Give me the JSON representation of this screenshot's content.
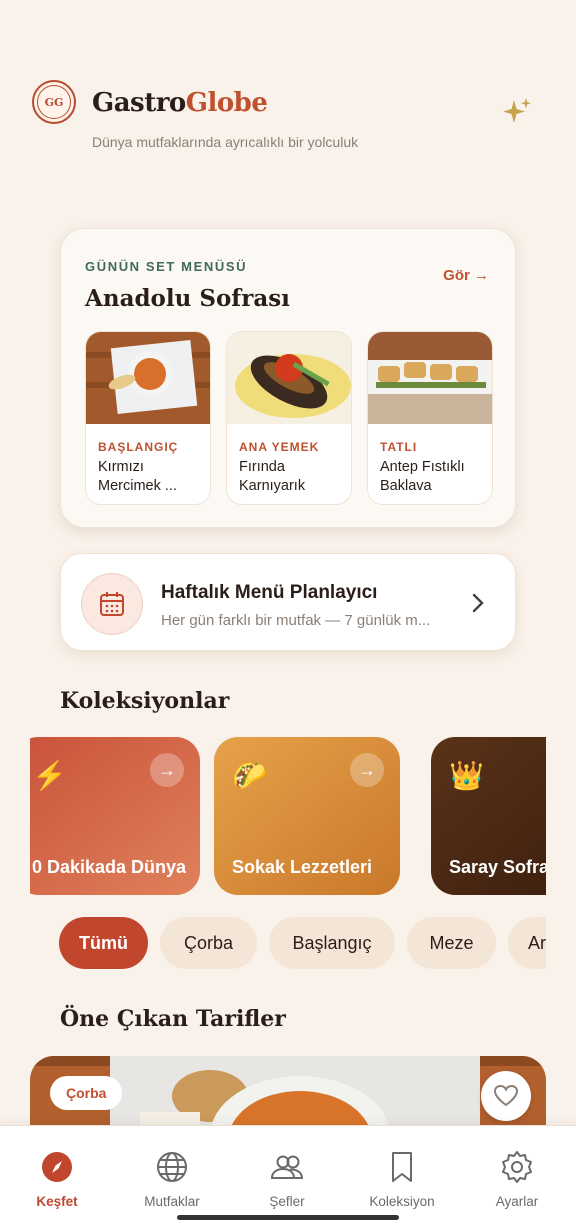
{
  "app": {
    "brand_part1": "Gastro",
    "brand_part2": "Globe",
    "logo_text": "GG",
    "tagline": "Dünya mutfaklarında ayrıcalıklı bir yolculuk",
    "accent_color": "#c0512f"
  },
  "set_menu": {
    "eyebrow": "GÜNÜN SET MENÜSÜ",
    "title": "Anadolu Sofrası",
    "see_all": "Gör →",
    "dishes": [
      {
        "category": "BAŞLANGIÇ",
        "name": "Kırmızı Mercimek ..."
      },
      {
        "category": "ANA YEMEK",
        "name": "Fırında Karnıyarık"
      },
      {
        "category": "TATLI",
        "name": "Antep Fıstıklı Baklava"
      }
    ]
  },
  "planner": {
    "title": "Haftalık Menü Planlayıcı",
    "subtitle": "Her gün farklı bir mutfak — 7 günlük m...",
    "icon": "calendar-icon"
  },
  "collections": {
    "title": "Koleksiyonlar",
    "items": [
      {
        "label": "0 Dakikada Dünya",
        "emoji": "⚡"
      },
      {
        "label": "Sokak Lezzetleri",
        "emoji": "🌮"
      },
      {
        "label": "Saray Sofrası",
        "emoji": "👑"
      }
    ]
  },
  "categories": {
    "selected": "Tümü",
    "items": [
      "Tümü",
      "Çorba",
      "Başlangıç",
      "Meze",
      "Ara"
    ]
  },
  "featured": {
    "title": "Öne Çıkan Tarifler",
    "badge": "Çorba"
  },
  "nav": {
    "items": [
      {
        "label": "Keşfet",
        "icon": "compass-icon"
      },
      {
        "label": "Mutfaklar",
        "icon": "globe-icon"
      },
      {
        "label": "Şefler",
        "icon": "people-icon"
      },
      {
        "label": "Koleksiyon",
        "icon": "bookmark-icon"
      },
      {
        "label": "Ayarlar",
        "icon": "gear-icon"
      }
    ],
    "active": "Keşfet"
  }
}
